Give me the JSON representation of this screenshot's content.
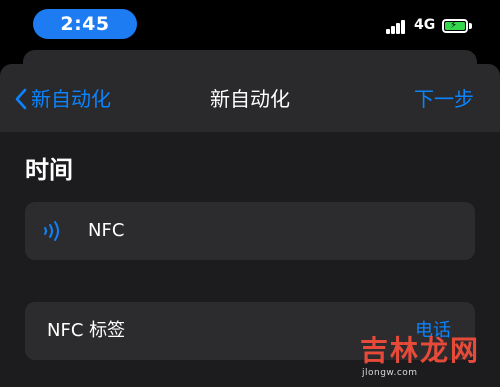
{
  "status_bar": {
    "time": "2:45",
    "network": "4G",
    "battery_color": "#32d74b"
  },
  "nav": {
    "back_label": "新自动化",
    "title": "新自动化",
    "next_label": "下一步"
  },
  "section": {
    "title": "时间"
  },
  "nfc_row": {
    "icon": "nfc-icon",
    "label": "NFC"
  },
  "tag_row": {
    "label": "NFC 标签",
    "value": "电话"
  },
  "watermark": {
    "text": "吉林龙网",
    "sub": "jlongw.com"
  },
  "colors": {
    "accent": "#0a84ff",
    "pill": "#1d7cf2",
    "background": "#1c1c1e",
    "card": "#2c2c2e"
  }
}
